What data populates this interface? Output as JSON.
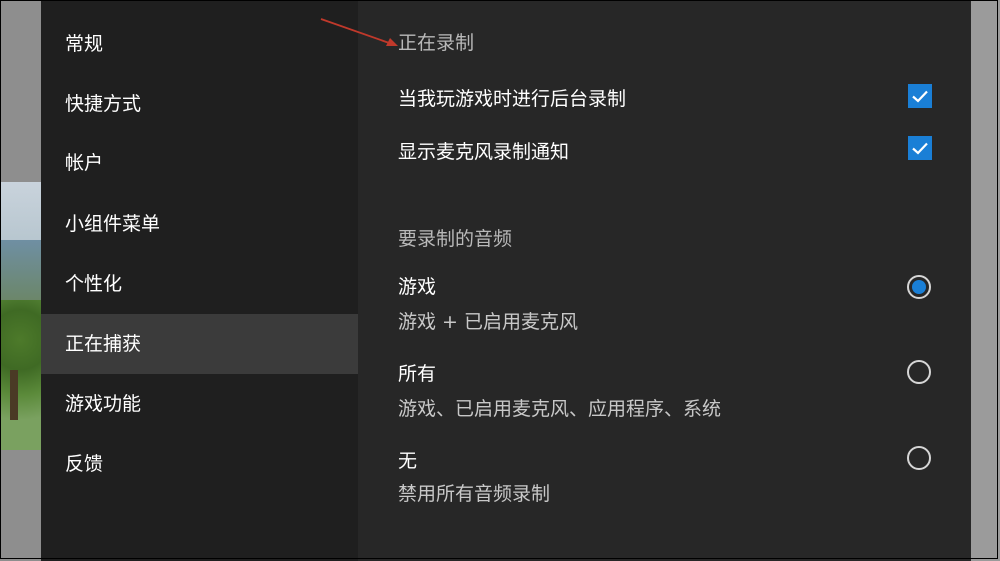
{
  "sidebar": {
    "items": [
      {
        "label": "常规",
        "active": false
      },
      {
        "label": "快捷方式",
        "active": false
      },
      {
        "label": "帐户",
        "active": false
      },
      {
        "label": "小组件菜单",
        "active": false
      },
      {
        "label": "个性化",
        "active": false
      },
      {
        "label": "正在捕获",
        "active": true
      },
      {
        "label": "游戏功能",
        "active": false
      },
      {
        "label": "反馈",
        "active": false
      }
    ]
  },
  "main": {
    "recording_section_title": "正在录制",
    "background_recording": {
      "label": "当我玩游戏时进行后台录制",
      "checked": true
    },
    "mic_notification": {
      "label": "显示麦克风录制通知",
      "checked": true
    },
    "audio_section_title": "要录制的音频",
    "audio_options": [
      {
        "title": "游戏",
        "subtitle": "游戏 + 已启用麦克风",
        "selected": true
      },
      {
        "title": "所有",
        "subtitle": "游戏、已启用麦克风、应用程序、系统",
        "selected": false
      },
      {
        "title": "无",
        "subtitle": "禁用所有音频录制",
        "selected": false
      }
    ]
  },
  "colors": {
    "accent": "#1a7fd6",
    "annotation_arrow": "#c0392b"
  }
}
